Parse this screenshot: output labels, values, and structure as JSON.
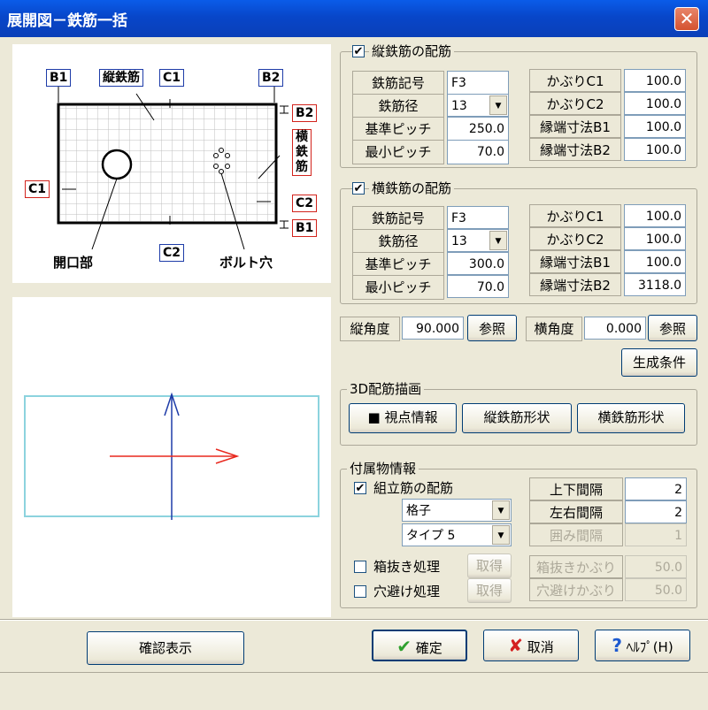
{
  "window": {
    "title": "展開図－鉄筋一括",
    "close_glyph": "✕"
  },
  "diagram": {
    "B1": "B1",
    "B2": "B2",
    "C1": "C1",
    "C2": "C2",
    "vertical_rebar": "縦鉄筋",
    "horizontal_rebar": "横鉄筋",
    "opening": "開口部",
    "bolt_hole": "ボルト穴"
  },
  "vertical": {
    "title": "縦鉄筋の配筋",
    "checked": true,
    "rows": [
      {
        "label": "鉄筋記号",
        "value": "F3"
      },
      {
        "label": "鉄筋径",
        "value": "13"
      },
      {
        "label": "基準ピッチ",
        "value": "250.0"
      },
      {
        "label": "最小ピッチ",
        "value": "70.0"
      }
    ],
    "rows_right": [
      {
        "label": "かぶりC1",
        "value": "100.0"
      },
      {
        "label": "かぶりC2",
        "value": "100.0"
      },
      {
        "label": "縁端寸法B1",
        "value": "100.0"
      },
      {
        "label": "縁端寸法B2",
        "value": "100.0"
      }
    ]
  },
  "horizontal": {
    "title": "横鉄筋の配筋",
    "checked": true,
    "rows": [
      {
        "label": "鉄筋記号",
        "value": "F3"
      },
      {
        "label": "鉄筋径",
        "value": "13"
      },
      {
        "label": "基準ピッチ",
        "value": "300.0"
      },
      {
        "label": "最小ピッチ",
        "value": "70.0"
      }
    ],
    "rows_right": [
      {
        "label": "かぶりC1",
        "value": "100.0"
      },
      {
        "label": "かぶりC2",
        "value": "100.0"
      },
      {
        "label": "縁端寸法B1",
        "value": "100.0"
      },
      {
        "label": "縁端寸法B2",
        "value": "3118.0"
      }
    ]
  },
  "angles": {
    "v_label": "縦角度",
    "v_value": "90.000",
    "v_ref": "参照",
    "h_label": "横角度",
    "h_value": "0.000",
    "h_ref": "参照"
  },
  "generate_button": "生成条件",
  "draw3d": {
    "title": "3D配筋描画",
    "viewpoint": "■ 視点情報",
    "vertical_shape": "縦鉄筋形状",
    "horizontal_shape": "横鉄筋形状"
  },
  "accessory": {
    "title": "付属物情報",
    "assembly": {
      "label": "組立筋の配筋",
      "checked": true,
      "pattern": "格子",
      "type": "タイプ 5"
    },
    "spacing": [
      {
        "label": "上下間隔",
        "value": "2",
        "disabled": false
      },
      {
        "label": "左右間隔",
        "value": "2",
        "disabled": false
      },
      {
        "label": "囲み間隔",
        "value": "1",
        "disabled": true
      }
    ],
    "boxout": {
      "label": "箱抜き処理",
      "checked": false,
      "button": "取得",
      "cover_label": "箱抜きかぶり",
      "cover_value": "50.0"
    },
    "holeavoid": {
      "label": "穴避け処理",
      "checked": false,
      "button": "取得",
      "cover_label": "穴避けかぶり",
      "cover_value": "50.0"
    }
  },
  "buttons": {
    "confirm_view": "確認表示",
    "ok": "確定",
    "cancel": "取消",
    "help": "ﾍﾙﾌﾟ(H)"
  },
  "colors": {
    "titlebar": "#0a50d8",
    "preview_frame": "#8cd3de",
    "arrow_red": "#e8281e",
    "arrow_blue": "#1e3ca8",
    "label_blue": "#1e3ca8",
    "label_red": "#d2231c"
  }
}
